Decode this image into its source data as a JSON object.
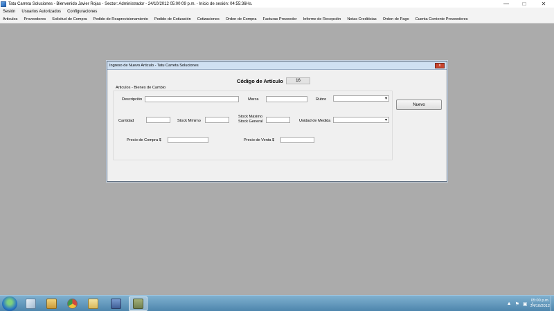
{
  "window": {
    "title": "Tatu Carreta Soluciones  -  Bienvenido Javier Rojas - Sector: Administrador   -  24/10/2012 05:00:09 p.m.   -  Inicio de sesión: 04:55:36Hs.",
    "minimize_glyph": "—",
    "maximize_glyph": "□",
    "close_glyph": "✕"
  },
  "menu": {
    "items": [
      "Sesión",
      "Usuarios Autorizados",
      "Configuraciones"
    ]
  },
  "submenu": {
    "items": [
      "Articulos",
      "Proveedores",
      "Solicitud de Compra",
      "Pedido de Reaprovisionamiento",
      "Pedido de Cotización",
      "Cotizaciones",
      "Orden de Compra",
      "Facturas Proveedor",
      "Informe de Recepción",
      "Notas Crediticias",
      "Orden de Pago",
      "Cuenta Corriente Proveedores"
    ]
  },
  "dialog": {
    "title": "Ingreso de Nuevo Articulo - Tatu Carreta Soluciones",
    "close_glyph": "x",
    "code_label": "Código de Artículo",
    "code_value": "16",
    "group_label": "Articulos - Bienes de Cambio",
    "labels": {
      "descripcion": "Descripción",
      "marca": "Marca",
      "rubro": "Rubro",
      "cantidad": "Cantidad",
      "stock_minimo": "Stock Mínimo",
      "stock_maximo": "Stock Máximo",
      "stock_general": "Stock General",
      "unidad_medida": "Unidad de Medida",
      "precio_compra": "Precio de Compra  $",
      "precio_venta": "Precio de Venta  $"
    },
    "fields": {
      "descripcion": "",
      "marca": "",
      "rubro": "",
      "cantidad": "",
      "stock_minimo": "",
      "stock_maximo": "",
      "unidad_medida": "",
      "precio_compra": "",
      "precio_venta": ""
    },
    "nuevo_button": "Nuevo"
  },
  "taskbar": {
    "pinned": [
      {
        "icon": "windows-explorer-icon",
        "color": "#d8a84a"
      },
      {
        "icon": "chrome-icon",
        "color": "#d24a3c"
      },
      {
        "icon": "file-manager-icon",
        "color": "#e6c45a"
      },
      {
        "icon": "visual-studio-icon",
        "color": "#5a7fb6"
      },
      {
        "icon": "tatu-app-icon",
        "color": "#6f7f4f"
      }
    ],
    "clock_time": "05:00 p.m.",
    "clock_date": "24/10/2012",
    "tray_icons": [
      "▲",
      "⚑",
      "▣",
      "♪"
    ]
  }
}
